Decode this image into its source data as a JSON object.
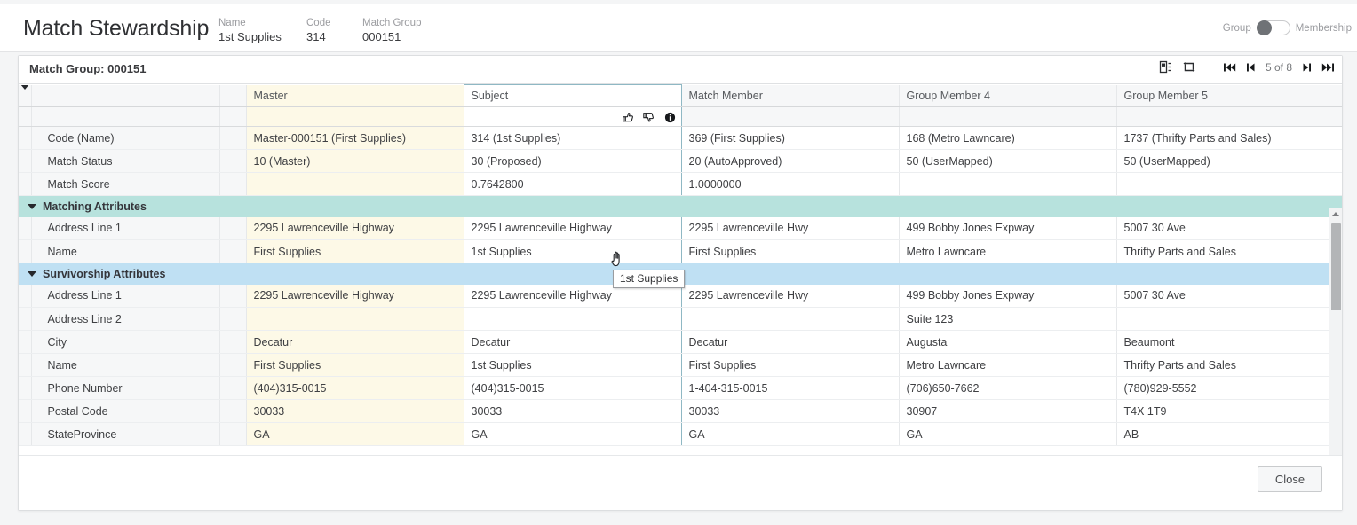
{
  "header": {
    "title": "Match Stewardship",
    "meta": [
      {
        "label": "Name",
        "value": "1st Supplies"
      },
      {
        "label": "Code",
        "value": "314"
      },
      {
        "label": "Match Group",
        "value": "000151"
      }
    ],
    "toggle": {
      "left_label": "Group",
      "right_label": "Membership",
      "state": "Group"
    }
  },
  "card": {
    "group_title": "Match Group: 000151",
    "toolbar": {
      "icons": [
        {
          "name": "column-settings-icon",
          "title": "Column Settings"
        },
        {
          "name": "swap-arrows-icon",
          "title": "Swap"
        }
      ],
      "pager": {
        "first_label": "First",
        "prev_label": "Previous",
        "position": "5 of 8",
        "next_label": "Next",
        "last_label": "Last"
      }
    },
    "columns": [
      {
        "key": "master",
        "label": "Master"
      },
      {
        "key": "subject",
        "label": "Subject"
      },
      {
        "key": "member",
        "label": "Match Member"
      },
      {
        "key": "gm4",
        "label": "Group Member 4"
      },
      {
        "key": "gm5",
        "label": "Group Member 5"
      }
    ],
    "subject_actions": [
      {
        "name": "thumbs-up-icon",
        "label": "Approve"
      },
      {
        "name": "thumbs-down-icon",
        "label": "Reject"
      },
      {
        "name": "info-icon",
        "label": "Info"
      }
    ],
    "top_rows": [
      {
        "label": "Code (Name)",
        "values": [
          "Master-000151 (First Supplies)",
          "314 (1st Supplies)",
          "369 (First Supplies)",
          "168 (Metro Lawncare)",
          "1737 (Thrifty Parts and Sales)"
        ]
      },
      {
        "label": "Match Status",
        "values": [
          "10 (Master)",
          "30 (Proposed)",
          "20 (AutoApproved)",
          "50 (UserMapped)",
          "50 (UserMapped)"
        ]
      },
      {
        "label": "Match Score",
        "values": [
          "",
          "0.7642800",
          "1.0000000",
          "",
          ""
        ]
      }
    ],
    "sections": [
      {
        "title": "Matching Attributes",
        "expanded": true,
        "rows": [
          {
            "label": "Address Line 1",
            "values": [
              "2295 Lawrenceville Highway",
              "2295 Lawrenceville Highway",
              "2295 Lawrenceville Hwy",
              "499 Bobby Jones Expway",
              "5007 30 Ave"
            ]
          },
          {
            "label": "Name",
            "values": [
              "First Supplies",
              "1st Supplies",
              "First Supplies",
              "Metro Lawncare",
              "Thrifty Parts and Sales"
            ]
          }
        ]
      },
      {
        "title": "Survivorship Attributes",
        "expanded": true,
        "rows": [
          {
            "label": "Address Line 1",
            "values": [
              "2295 Lawrenceville Highway",
              "2295 Lawrenceville Highway",
              "2295 Lawrenceville Hwy",
              "499 Bobby Jones Expway",
              "5007 30 Ave"
            ]
          },
          {
            "label": "Address Line 2",
            "values": [
              "",
              "",
              "",
              "Suite 123",
              ""
            ]
          },
          {
            "label": "City",
            "values": [
              "Decatur",
              "Decatur",
              "Decatur",
              "Augusta",
              "Beaumont"
            ]
          },
          {
            "label": "Name",
            "values": [
              "First Supplies",
              "1st Supplies",
              "First Supplies",
              "Metro Lawncare",
              "Thrifty Parts and Sales"
            ]
          },
          {
            "label": "Phone Number",
            "values": [
              "(404)315-0015",
              "(404)315-0015",
              "1-404-315-0015",
              "(706)650-7662",
              "(780)929-5552"
            ]
          },
          {
            "label": "Postal Code",
            "values": [
              "30033",
              "30033",
              "30033",
              "30907",
              "T4X 1T9"
            ]
          },
          {
            "label": "StateProvince",
            "values": [
              "GA",
              "GA",
              "GA",
              "GA",
              "AB"
            ]
          }
        ]
      }
    ]
  },
  "tooltip": {
    "text": "1st Supplies"
  },
  "footer": {
    "close_label": "Close"
  },
  "colors": {
    "master_column": "#fdf9e7",
    "subject_border": "#8fb8c4",
    "matching_header": "#b7e2dd",
    "survivorship_header": "#bfe0f3",
    "label_column": "#f6f7f8"
  }
}
